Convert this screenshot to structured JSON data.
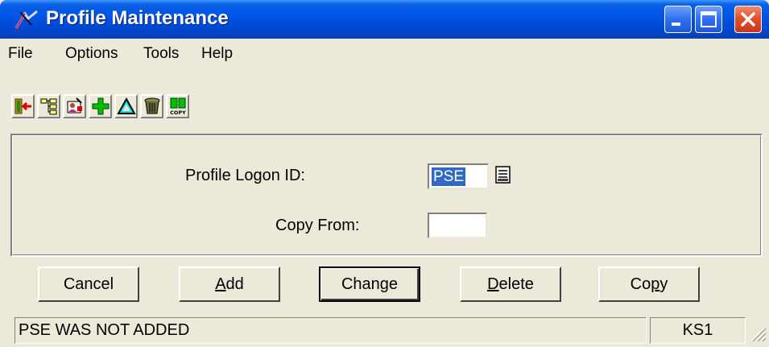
{
  "window": {
    "title": "Profile Maintenance",
    "icon": "app-logo-icon"
  },
  "title_buttons": [
    "minimize-icon",
    "maximize-icon",
    "close-icon"
  ],
  "menu": {
    "items": [
      {
        "label": "File"
      },
      {
        "label": "Options"
      },
      {
        "label": "Tools"
      },
      {
        "label": "Help"
      }
    ]
  },
  "toolbar": {
    "buttons": [
      {
        "icon": "exit-door-icon"
      },
      {
        "icon": "tree-structure-icon"
      },
      {
        "icon": "profile-edit-icon"
      },
      {
        "icon": "add-plus-icon"
      },
      {
        "icon": "change-triangle-icon"
      },
      {
        "icon": "trash-can-icon"
      },
      {
        "icon": "copy-icon",
        "text": "COPY"
      }
    ]
  },
  "form": {
    "logon_label": "Profile Logon ID:",
    "logon_value": "PSE",
    "lookup_icon": "list-lookup-icon",
    "copy_from_label": "Copy From:",
    "copy_from_value": ""
  },
  "buttons": {
    "cancel": "Cancel",
    "add_u": "A",
    "add_rest": "dd",
    "change": "Change",
    "delete_u": "D",
    "delete_rest": "elete",
    "copy_pre": "Co",
    "copy_u": "p",
    "copy_post": "y"
  },
  "status": {
    "message": "PSE  WAS NOT ADDED",
    "code": "KS1"
  },
  "colors": {
    "titlebar": "#0055e5",
    "face": "#ece9d8",
    "selection": "#316ac5"
  }
}
